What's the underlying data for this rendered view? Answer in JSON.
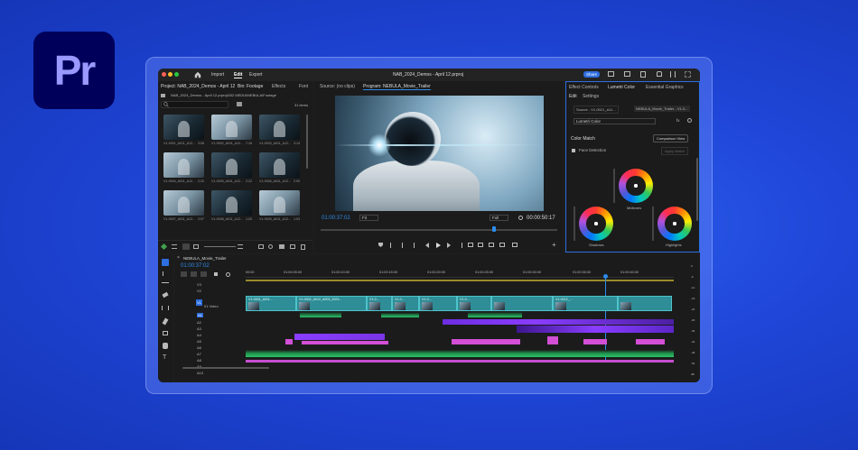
{
  "logo": {
    "text": "Pr"
  },
  "colors": {
    "accent": "#2d8ceb",
    "video_clip": "#2e8d96",
    "audio_green": "#2bc36a",
    "audio_purple": "#8a3dff",
    "audio_pink": "#d24fd6",
    "playhead": "#2d8ceb"
  },
  "topbar": {
    "nav": [
      "Import",
      "Edit",
      "Export"
    ],
    "project_title": "NAB_2024_Demos - April 12.prproj",
    "share_label": "Share"
  },
  "project_panel": {
    "tabs": [
      "Project: NAB_2024_Demos - April 12",
      "Bin: Footage",
      "Effects",
      "Font"
    ],
    "path": "NAB_2024_Demos - April 12.prproj\\002 MEDIA\\NEBULA\\Footage",
    "item_count": "31 items",
    "thumbnails": [
      {
        "name": "V1-0001_A011_A12...",
        "dur": "3:08"
      },
      {
        "name": "V1-0002_A011_A12...",
        "dur": "7:16"
      },
      {
        "name": "V1-0003_A011_A12...",
        "dur": "3:14"
      },
      {
        "name": "V1-0004_A011_A12...",
        "dur": "2:20"
      },
      {
        "name": "V1-0005_A011_A12...",
        "dur": "2:22"
      },
      {
        "name": "V1-0006_A011_A12...",
        "dur": "2:00"
      },
      {
        "name": "V1-0007_A011_A12...",
        "dur": "2:07"
      },
      {
        "name": "V1-0008_A011_A12...",
        "dur": "1:20"
      },
      {
        "name": "V1-0009_A011_A12...",
        "dur": "1:03"
      }
    ]
  },
  "monitor": {
    "tabs": [
      "Source: (no clips)",
      "Program: NEBULA_Movie_Trailer"
    ],
    "current_timecode": "01:00:37:02",
    "fit": "Fit",
    "quality": "Full",
    "duration": "00:00:50:17"
  },
  "effect_controls": {
    "tabs": [
      "Effect Controls",
      "Lumetri Color",
      "Essential Graphics"
    ],
    "subtabs": [
      "Edit",
      "Settings"
    ],
    "source_clip": "Source - V1-0021_A11...",
    "sequence_clip": "NEBULA_Movie_Trailer - V1-0...",
    "effect": "Lumetri Color",
    "fx_label": "fx",
    "section": "Color Match",
    "comparison_view": "Comparison View",
    "face_detection": "Face Detection",
    "apply_match": "Apply Match",
    "wheels": [
      "Midtones",
      "Shadows",
      "Highlights"
    ]
  },
  "timeline": {
    "sequence_name": "NEBULA_Movie_Trailer",
    "timecode": "01:00:37:02",
    "ruler": [
      "00:00",
      "01:00:05:00",
      "01:00:10:00",
      "01:00:15:00",
      "01:00:20:00",
      "01:00:25:00",
      "01:00:30:00",
      "01:00:35:00",
      "01:00:40:00"
    ],
    "tracks_video": [
      "V3",
      "V2",
      "V1"
    ],
    "v1_name": "01 Video",
    "tracks_audio": [
      "A1",
      "A2",
      "A3",
      "A4",
      "A5",
      "A6",
      "A7",
      "A8",
      "A9",
      "A10"
    ],
    "clip_labels": [
      "V1-0001_A011...",
      "V1-0002_A012_A003_2023...",
      "V1-0...",
      "V1-0...",
      "V1-0...",
      "V1-0...",
      "V1-0012_..."
    ],
    "meter_ticks": [
      "0",
      "-6",
      "-12",
      "-18",
      "-24",
      "-30",
      "-36",
      "-42",
      "-48",
      "-54"
    ],
    "meter_label": "dB"
  }
}
